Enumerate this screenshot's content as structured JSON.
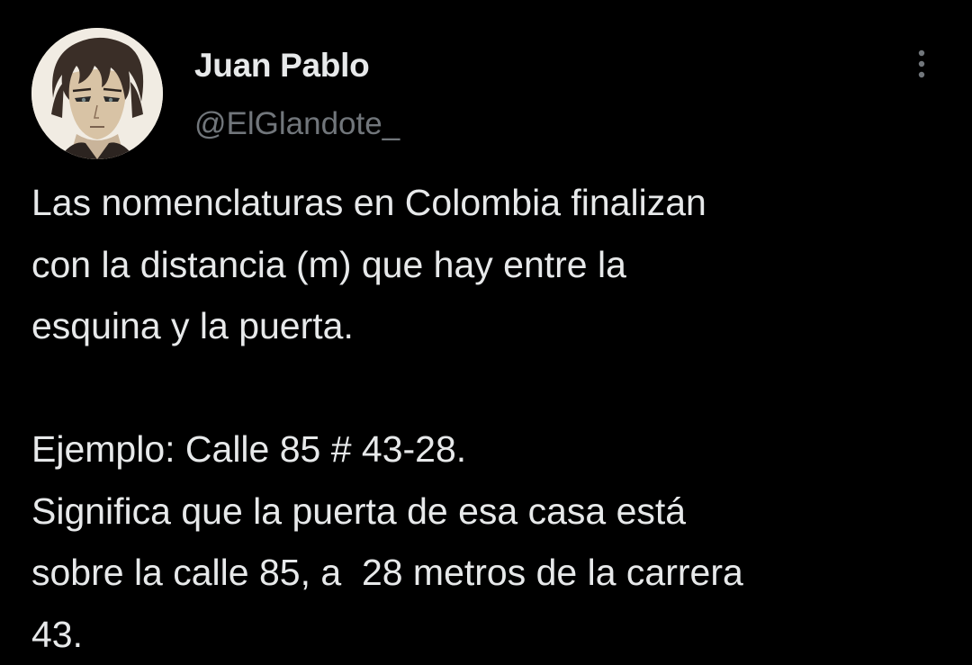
{
  "author": {
    "name": "Juan Pablo",
    "handle": "@ElGlandote_",
    "avatar_icon": "anime-character-avatar"
  },
  "menu": {
    "icon": "more-vertical-icon"
  },
  "tweet": {
    "paragraph1": [
      "Las nomenclaturas en Colombia finalizan",
      "con la distancia (m) que hay entre la",
      "esquina y la puerta."
    ],
    "paragraph2": [
      "Ejemplo: Calle 85 # 43-28.",
      "Significa que la puerta de esa casa está",
      "sobre la calle 85, a  28 metros de la carrera",
      "43."
    ]
  },
  "colors": {
    "background": "#000000",
    "primary_text": "#e7e9ea",
    "secondary_text": "#71767b"
  }
}
